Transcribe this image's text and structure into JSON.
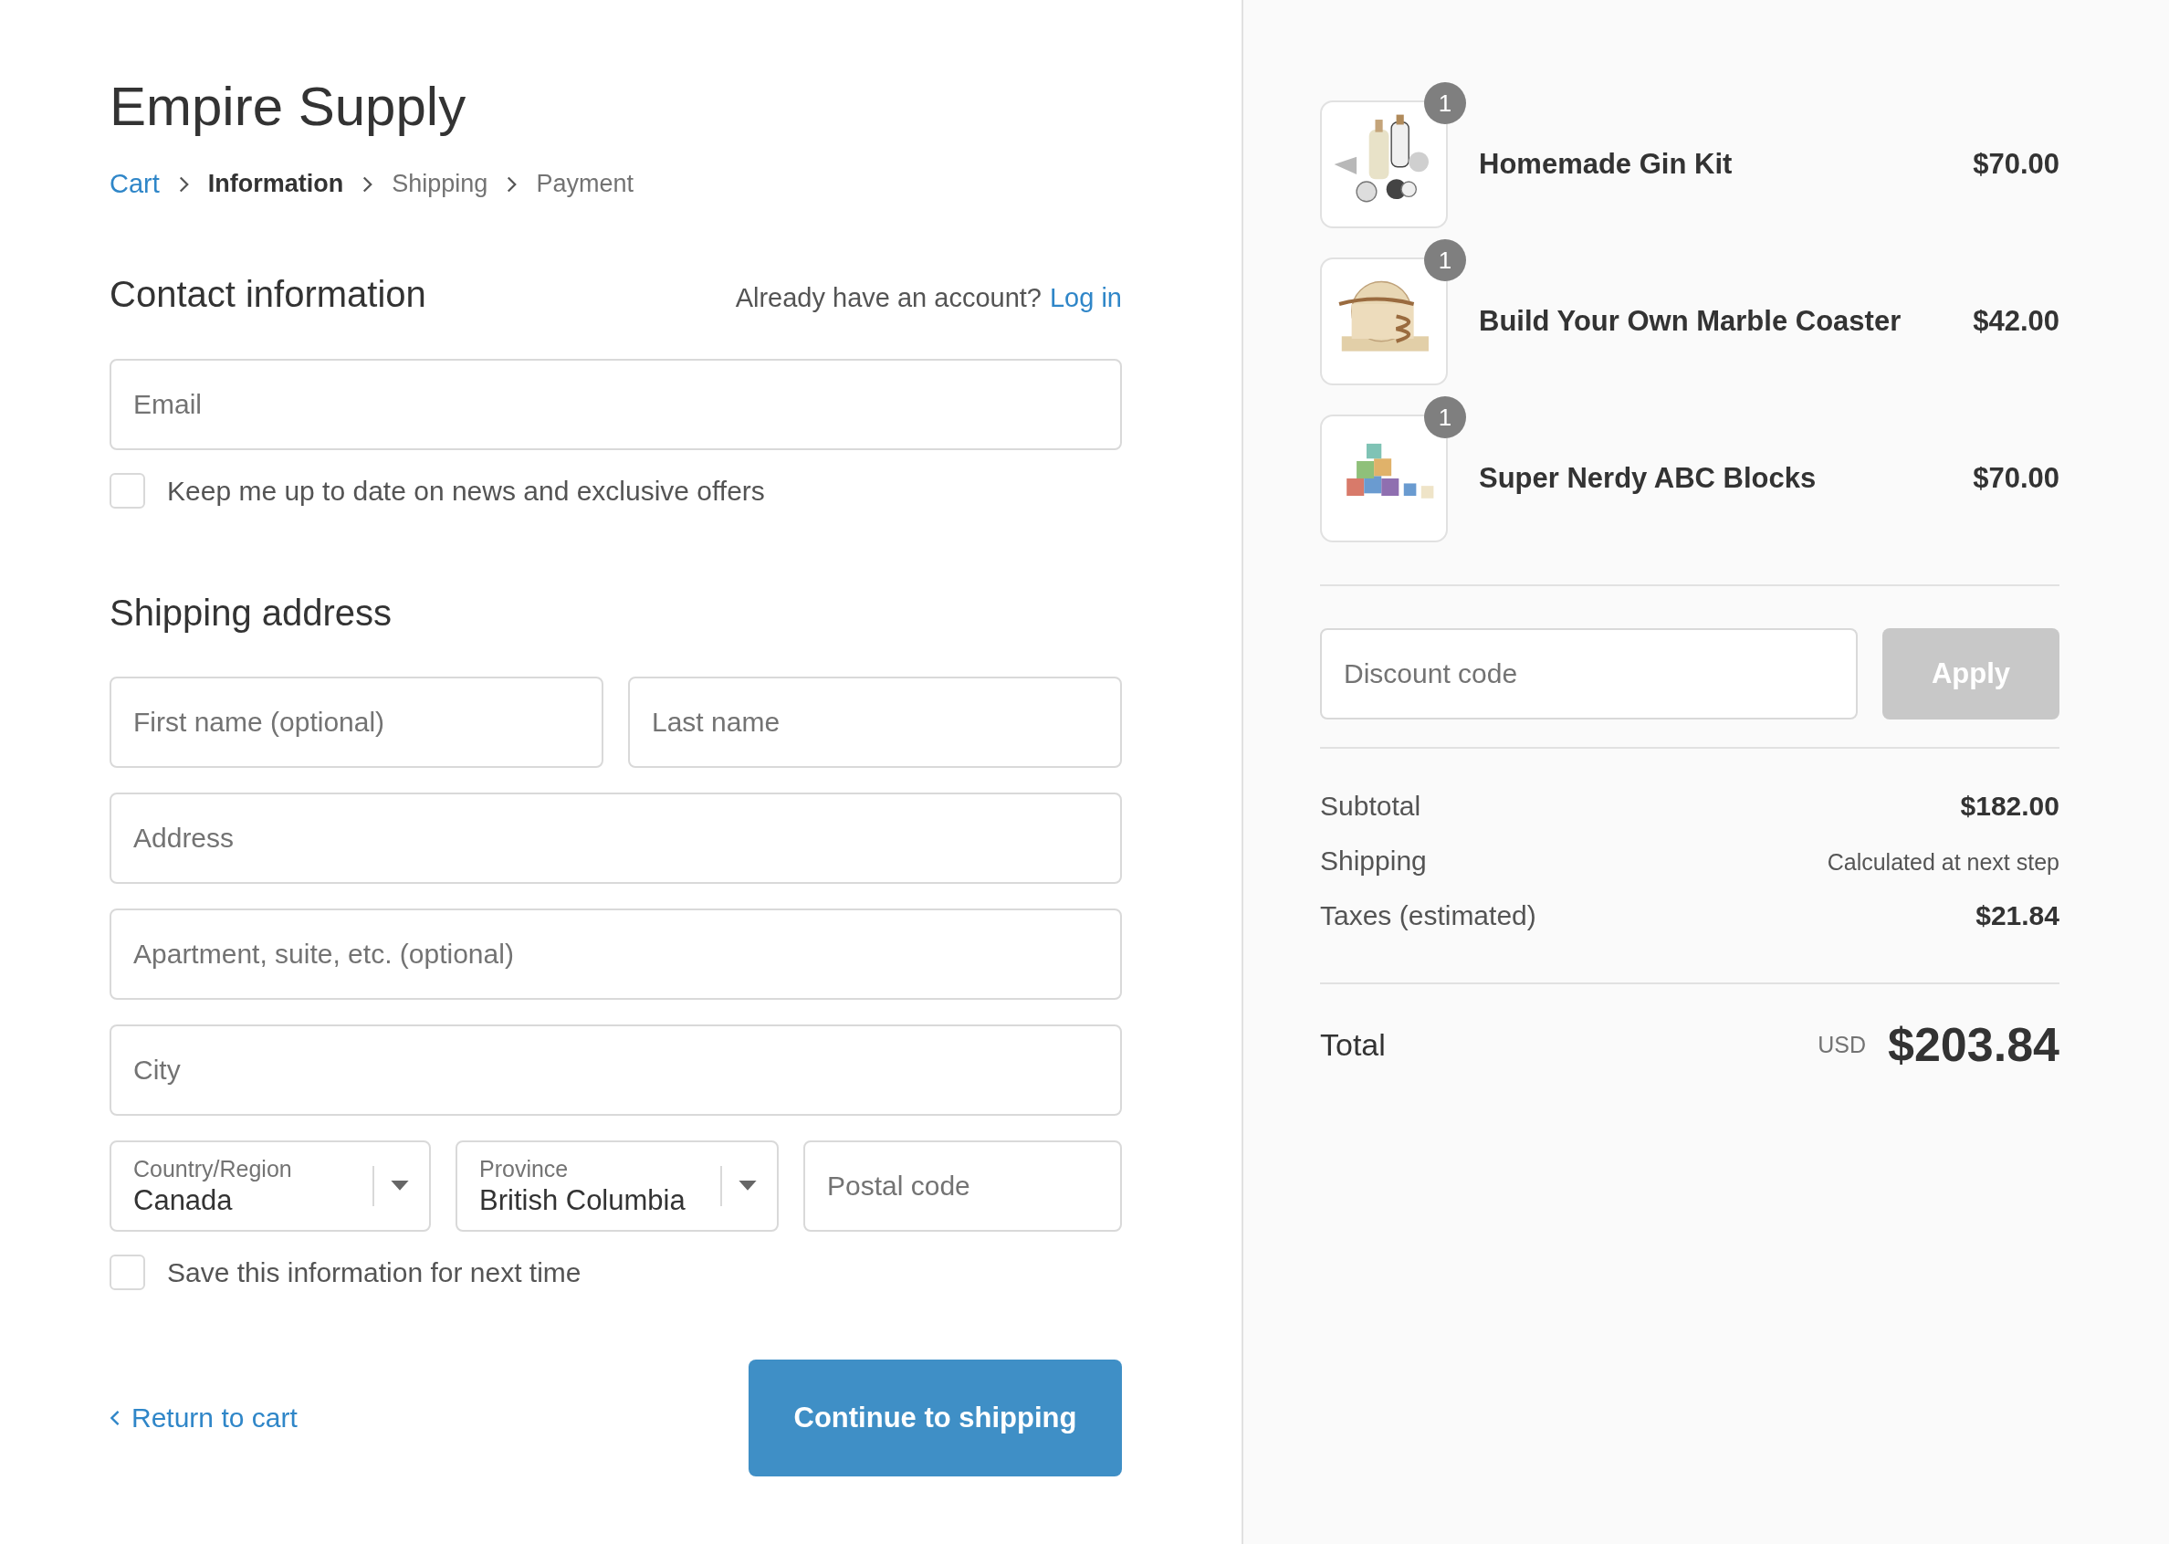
{
  "store": {
    "name": "Empire Supply"
  },
  "breadcrumb": [
    {
      "label": "Cart",
      "kind": "link"
    },
    {
      "label": "Information",
      "kind": "current"
    },
    {
      "label": "Shipping",
      "kind": "step"
    },
    {
      "label": "Payment",
      "kind": "step"
    }
  ],
  "contact": {
    "title": "Contact information",
    "account_prompt": "Already have an account?",
    "login_link": "Log in",
    "email": {
      "placeholder": "Email"
    },
    "newsletter": {
      "label": "Keep me up to date on news and exclusive offers",
      "checked": false
    }
  },
  "shipping_address": {
    "title": "Shipping address",
    "first_name": {
      "placeholder": "First name (optional)"
    },
    "last_name": {
      "placeholder": "Last name"
    },
    "address": {
      "placeholder": "Address"
    },
    "apartment": {
      "placeholder": "Apartment, suite, etc. (optional)"
    },
    "city": {
      "placeholder": "City"
    },
    "country": {
      "label": "Country/Region",
      "value": "Canada"
    },
    "province": {
      "label": "Province",
      "value": "British Columbia"
    },
    "postal_code": {
      "placeholder": "Postal code"
    },
    "save_info": {
      "label": "Save this information for next time",
      "checked": false
    }
  },
  "actions": {
    "return_link": "Return to cart",
    "continue_button": "Continue to shipping"
  },
  "order": {
    "items": [
      {
        "name": "Homemade Gin Kit",
        "price": "$70.00",
        "quantity": "1"
      },
      {
        "name": "Build Your Own Marble Coaster",
        "price": "$42.00",
        "quantity": "1"
      },
      {
        "name": "Super Nerdy ABC Blocks",
        "price": "$70.00",
        "quantity": "1"
      }
    ],
    "discount": {
      "placeholder": "Discount code",
      "button": "Apply",
      "disabled": true
    },
    "summary": [
      {
        "label": "Subtotal",
        "value": "$182.00",
        "kind": "amount"
      },
      {
        "label": "Shipping",
        "value": "Calculated at next step",
        "kind": "note"
      },
      {
        "label": "Taxes (estimated)",
        "value": "$21.84",
        "kind": "amount"
      }
    ],
    "total": {
      "label": "Total",
      "currency": "USD",
      "amount": "$203.84"
    }
  }
}
